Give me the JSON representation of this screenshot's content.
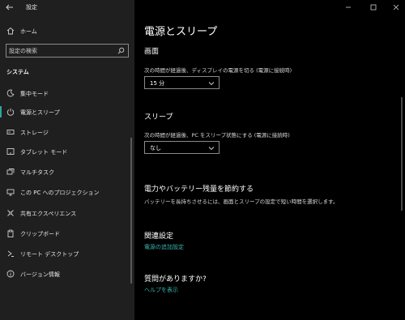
{
  "window": {
    "title": "設定",
    "controls": [
      "minimize-icon",
      "maximize-icon",
      "close-icon"
    ]
  },
  "sidebar": {
    "home_label": "ホーム",
    "search_placeholder": "設定の検索",
    "section_label": "システム",
    "items": [
      {
        "label": "集中モード",
        "icon": "moon-icon",
        "selected": false
      },
      {
        "label": "電源とスリープ",
        "icon": "power-icon",
        "selected": true
      },
      {
        "label": "ストレージ",
        "icon": "storage-icon",
        "selected": false
      },
      {
        "label": "タブレット モード",
        "icon": "tablet-icon",
        "selected": false
      },
      {
        "label": "マルチタスク",
        "icon": "multitask-icon",
        "selected": false
      },
      {
        "label": "この PC へのプロジェクション",
        "icon": "projection-icon",
        "selected": false
      },
      {
        "label": "共有エクスペリエンス",
        "icon": "shared-icon",
        "selected": false
      },
      {
        "label": "クリップボード",
        "icon": "clipboard-icon",
        "selected": false
      },
      {
        "label": "リモート デスクトップ",
        "icon": "remote-icon",
        "selected": false
      },
      {
        "label": "バージョン情報",
        "icon": "info-icon",
        "selected": false
      }
    ]
  },
  "main": {
    "title": "電源とスリープ",
    "screen": {
      "heading": "画面",
      "desc": "次の時間が経過後、ディスプレイの電源を切る (電源に接続時)",
      "value": "15 分"
    },
    "sleep": {
      "heading": "スリープ",
      "desc": "次の時間が経過後、PC をスリープ状態にする (電源に接続時)",
      "value": "なし"
    },
    "battery": {
      "heading": "電力やバッテリー残量を節約する",
      "desc": "バッテリーを長持ちさせるには、画面とスリープの設定で短い時間を選択します。"
    },
    "related": {
      "heading": "関連設定",
      "link": "電源の追加設定"
    },
    "question": {
      "heading": "質問がありますか?",
      "link": "ヘルプを表示"
    }
  },
  "colors": {
    "accent": "#2aa89a",
    "link": "#38b3a8",
    "sidebar_bg": "#1f1f1f",
    "main_bg": "#000000"
  }
}
